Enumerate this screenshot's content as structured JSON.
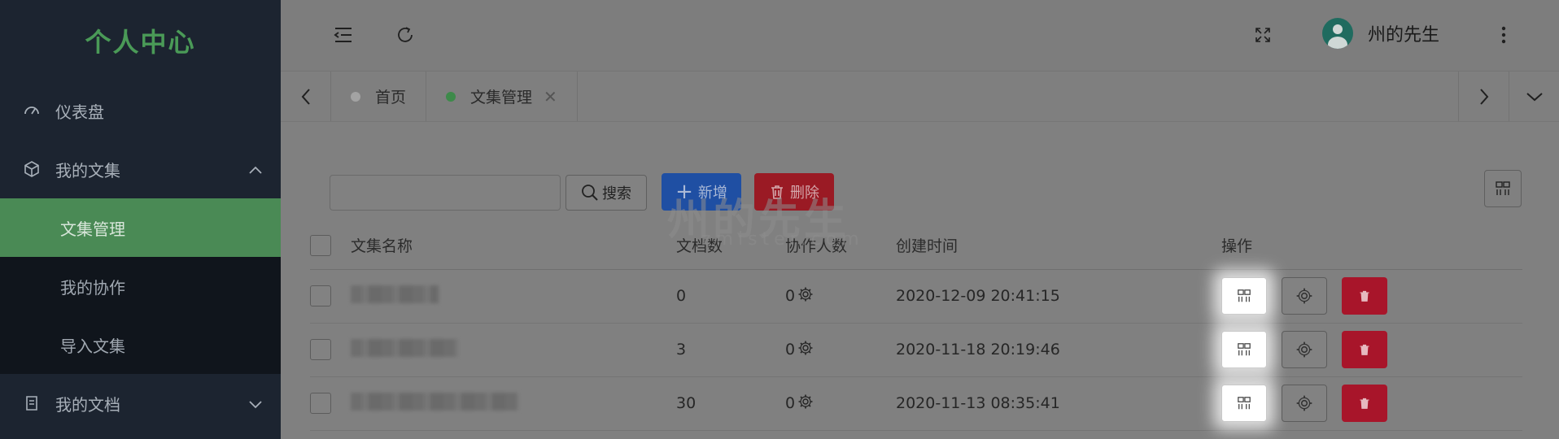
{
  "sidebar": {
    "logo": "个人中心",
    "items": [
      {
        "label": "仪表盘",
        "icon": "dashboard-icon"
      },
      {
        "label": "我的文集",
        "icon": "cube-icon",
        "expanded": true
      },
      {
        "label": "我的文档",
        "icon": "document-icon",
        "expanded": false
      }
    ],
    "submenu": [
      {
        "label": "文集管理",
        "active": true
      },
      {
        "label": "我的协作",
        "active": false
      },
      {
        "label": "导入文集",
        "active": false
      }
    ]
  },
  "header": {
    "username": "州的先生",
    "icons": [
      "collapse-menu-icon",
      "refresh-icon",
      "fullscreen-icon",
      "more-vertical-icon"
    ]
  },
  "tabs": [
    {
      "label": "首页",
      "active": false
    },
    {
      "label": "文集管理",
      "active": true,
      "closable": true
    }
  ],
  "toolbar": {
    "search_placeholder": "",
    "search_label": "搜索",
    "add_label": "新增",
    "delete_label": "删除"
  },
  "watermark": {
    "title": "州的先生",
    "sub": "zmister.com"
  },
  "table": {
    "headers": {
      "name": "文集名称",
      "docs": "文档数",
      "collab": "协作人数",
      "created": "创建时间",
      "ops": "操作"
    },
    "rows": [
      {
        "name": "",
        "docs": "0",
        "collab": "0",
        "created": "2020-12-09 20:41:15"
      },
      {
        "name": "",
        "docs": "3",
        "collab": "0",
        "created": "2020-11-18 20:19:46"
      },
      {
        "name": "",
        "docs": "30",
        "collab": "0",
        "created": "2020-11-13 08:35:41"
      }
    ]
  },
  "colors": {
    "sidebar_bg": "#1c2430",
    "accent_green": "#4a8a55",
    "primary_blue": "#1f4fa3",
    "danger_red": "#a8152a"
  }
}
